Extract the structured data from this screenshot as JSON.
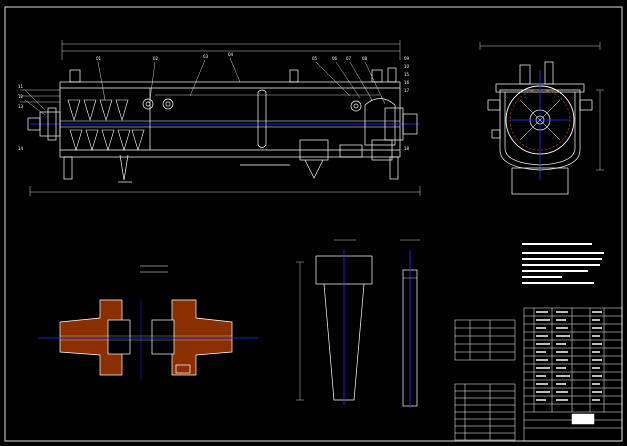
{
  "drawing": {
    "colors": {
      "background": "#000000",
      "outline": "#ffffff",
      "centerline": "#2b2bff",
      "dimension": "#3ad13a",
      "section_hatch": "#c04000",
      "border": "#dcdcdc"
    },
    "main_view": {
      "part_numbers": [
        "01",
        "02",
        "03",
        "04",
        "05",
        "06",
        "07",
        "08",
        "09",
        "10",
        "11",
        "12",
        "13",
        "14",
        "15",
        "16",
        "17",
        "18"
      ],
      "overall_dimension": "",
      "height_dimension": ""
    },
    "end_view": {
      "dimension_top": "",
      "dimension_side": ""
    },
    "detail_views": {
      "coupling_title": "",
      "coupling_scale": "",
      "blade_label": "",
      "blade_side_label": ""
    },
    "tables": {
      "tech_spec_title": "",
      "small_table_title": "",
      "parts_list_title": "",
      "title_block_name": ""
    }
  }
}
